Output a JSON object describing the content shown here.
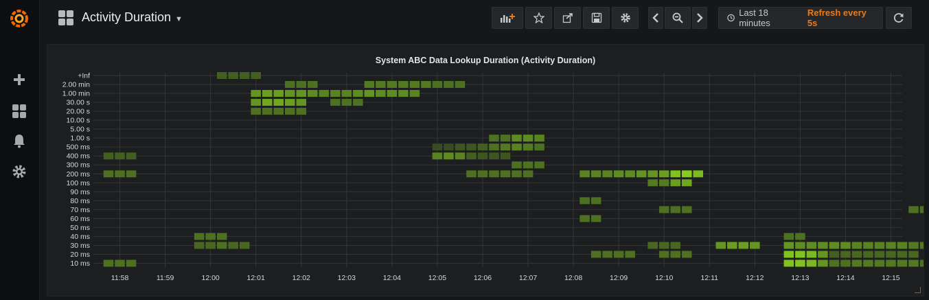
{
  "dashboard": {
    "title": "Activity Duration"
  },
  "toolbar": {
    "time_range": "Last 18 minutes",
    "refresh": "Refresh every 5s"
  },
  "icons": {
    "logo": "grafana-logo",
    "sidebar": [
      "plus-icon",
      "dashboards-icon",
      "bell-icon",
      "gear-icon"
    ],
    "toolbar": [
      "add-panel-icon",
      "star-icon",
      "share-icon",
      "save-icon",
      "settings-icon",
      "chevron-left-icon",
      "zoom-out-icon",
      "chevron-right-icon",
      "clock-icon",
      "refresh-icon"
    ]
  },
  "colors": {
    "accent": "#eb7b18",
    "cell_low": "#37591c",
    "cell_high": "#98ea1c"
  },
  "chart_data": {
    "type": "heatmap",
    "title": "System ABC Data Lookup Duration (Activity Duration)",
    "y_buckets": [
      "10 ms",
      "20 ms",
      "30 ms",
      "40 ms",
      "50 ms",
      "60 ms",
      "70 ms",
      "80 ms",
      "90 ms",
      "100 ms",
      "200 ms",
      "300 ms",
      "400 ms",
      "500 ms",
      "1.00 s",
      "5.00 s",
      "10.00 s",
      "20.00 s",
      "30.00 s",
      "1.00 min",
      "2.00 min",
      "+Inf"
    ],
    "x_ticks": [
      "11:58",
      "11:59",
      "12:00",
      "12:01",
      "12:02",
      "12:03",
      "12:04",
      "12:05",
      "12:06",
      "12:07",
      "12:08",
      "12:09",
      "12:10",
      "12:11",
      "12:12",
      "12:13",
      "12:14",
      "12:15"
    ],
    "x_start": "11:57:25",
    "x_end": "12:15:15",
    "slot_seconds": 15,
    "grid": true,
    "cells": [
      [
        "11:57:45",
        "10 ms",
        0.3
      ],
      [
        "11:58:00",
        "10 ms",
        0.3
      ],
      [
        "11:58:15",
        "10 ms",
        0.3
      ],
      [
        "11:57:45",
        "200 ms",
        0.3
      ],
      [
        "11:58:00",
        "200 ms",
        0.3
      ],
      [
        "11:58:15",
        "200 ms",
        0.3
      ],
      [
        "11:57:45",
        "400 ms",
        0.2
      ],
      [
        "11:58:00",
        "400 ms",
        0.2
      ],
      [
        "11:58:15",
        "400 ms",
        0.2
      ],
      [
        "11:59:45",
        "40 ms",
        0.3
      ],
      [
        "12:00:00",
        "40 ms",
        0.3
      ],
      [
        "12:00:15",
        "40 ms",
        0.3
      ],
      [
        "11:59:45",
        "30 ms",
        0.25
      ],
      [
        "12:00:00",
        "30 ms",
        0.25
      ],
      [
        "12:00:15",
        "30 ms",
        0.3
      ],
      [
        "12:00:30",
        "30 ms",
        0.25
      ],
      [
        "12:00:45",
        "30 ms",
        0.25
      ],
      [
        "12:00:15",
        "+Inf",
        0.2
      ],
      [
        "12:00:30",
        "+Inf",
        0.2
      ],
      [
        "12:00:45",
        "+Inf",
        0.2
      ],
      [
        "12:01:00",
        "+Inf",
        0.2
      ],
      [
        "12:01:00",
        "20.00 s",
        0.3
      ],
      [
        "12:01:15",
        "20.00 s",
        0.3
      ],
      [
        "12:01:30",
        "20.00 s",
        0.3
      ],
      [
        "12:01:45",
        "20.00 s",
        0.3
      ],
      [
        "12:02:00",
        "20.00 s",
        0.3
      ],
      [
        "12:01:00",
        "30.00 s",
        0.5
      ],
      [
        "12:01:15",
        "30.00 s",
        0.6
      ],
      [
        "12:01:30",
        "30.00 s",
        0.6
      ],
      [
        "12:01:45",
        "30.00 s",
        0.55
      ],
      [
        "12:02:00",
        "30.00 s",
        0.5
      ],
      [
        "12:02:45",
        "30.00 s",
        0.3
      ],
      [
        "12:03:00",
        "30.00 s",
        0.3
      ],
      [
        "12:03:15",
        "30.00 s",
        0.3
      ],
      [
        "12:01:00",
        "1.00 min",
        0.5
      ],
      [
        "12:01:15",
        "1.00 min",
        0.55
      ],
      [
        "12:01:30",
        "1.00 min",
        0.55
      ],
      [
        "12:01:45",
        "1.00 min",
        0.5
      ],
      [
        "12:02:00",
        "1.00 min",
        0.5
      ],
      [
        "12:02:15",
        "1.00 min",
        0.45
      ],
      [
        "12:02:30",
        "1.00 min",
        0.4
      ],
      [
        "12:02:45",
        "1.00 min",
        0.4
      ],
      [
        "12:03:00",
        "1.00 min",
        0.4
      ],
      [
        "12:03:15",
        "1.00 min",
        0.45
      ],
      [
        "12:03:30",
        "1.00 min",
        0.5
      ],
      [
        "12:03:45",
        "1.00 min",
        0.45
      ],
      [
        "12:04:00",
        "1.00 min",
        0.45
      ],
      [
        "12:04:15",
        "1.00 min",
        0.45
      ],
      [
        "12:04:30",
        "1.00 min",
        0.4
      ],
      [
        "12:01:45",
        "2.00 min",
        0.3
      ],
      [
        "12:02:00",
        "2.00 min",
        0.3
      ],
      [
        "12:02:15",
        "2.00 min",
        0.3
      ],
      [
        "12:03:30",
        "2.00 min",
        0.35
      ],
      [
        "12:03:45",
        "2.00 min",
        0.35
      ],
      [
        "12:04:00",
        "2.00 min",
        0.35
      ],
      [
        "12:04:15",
        "2.00 min",
        0.35
      ],
      [
        "12:04:30",
        "2.00 min",
        0.35
      ],
      [
        "12:04:45",
        "2.00 min",
        0.35
      ],
      [
        "12:05:00",
        "2.00 min",
        0.3
      ],
      [
        "12:05:15",
        "2.00 min",
        0.3
      ],
      [
        "12:05:30",
        "2.00 min",
        0.3
      ],
      [
        "12:05:00",
        "500 ms",
        0.1
      ],
      [
        "12:05:15",
        "500 ms",
        0.1
      ],
      [
        "12:05:30",
        "500 ms",
        0.15
      ],
      [
        "12:05:45",
        "500 ms",
        0.15
      ],
      [
        "12:06:00",
        "500 ms",
        0.2
      ],
      [
        "12:06:15",
        "500 ms",
        0.3
      ],
      [
        "12:06:30",
        "500 ms",
        0.35
      ],
      [
        "12:06:45",
        "500 ms",
        0.4
      ],
      [
        "12:07:00",
        "500 ms",
        0.35
      ],
      [
        "12:07:15",
        "500 ms",
        0.3
      ],
      [
        "12:05:00",
        "400 ms",
        0.4
      ],
      [
        "12:05:15",
        "400 ms",
        0.45
      ],
      [
        "12:05:30",
        "400 ms",
        0.4
      ],
      [
        "12:05:45",
        "400 ms",
        0.2
      ],
      [
        "12:06:00",
        "400 ms",
        0.15
      ],
      [
        "12:06:15",
        "400 ms",
        0.15
      ],
      [
        "12:06:30",
        "400 ms",
        0.15
      ],
      [
        "12:06:15",
        "1.00 s",
        0.3
      ],
      [
        "12:06:30",
        "1.00 s",
        0.3
      ],
      [
        "12:06:45",
        "1.00 s",
        0.45
      ],
      [
        "12:07:00",
        "1.00 s",
        0.45
      ],
      [
        "12:07:15",
        "1.00 s",
        0.4
      ],
      [
        "12:06:45",
        "300 ms",
        0.3
      ],
      [
        "12:07:00",
        "300 ms",
        0.3
      ],
      [
        "12:07:15",
        "300 ms",
        0.3
      ],
      [
        "12:05:45",
        "200 ms",
        0.3
      ],
      [
        "12:06:00",
        "200 ms",
        0.3
      ],
      [
        "12:06:15",
        "200 ms",
        0.3
      ],
      [
        "12:06:30",
        "200 ms",
        0.3
      ],
      [
        "12:06:45",
        "200 ms",
        0.3
      ],
      [
        "12:07:00",
        "200 ms",
        0.3
      ],
      [
        "12:08:15",
        "200 ms",
        0.4
      ],
      [
        "12:08:30",
        "200 ms",
        0.4
      ],
      [
        "12:08:45",
        "200 ms",
        0.4
      ],
      [
        "12:09:00",
        "200 ms",
        0.45
      ],
      [
        "12:09:15",
        "200 ms",
        0.45
      ],
      [
        "12:09:30",
        "200 ms",
        0.5
      ],
      [
        "12:09:45",
        "200 ms",
        0.5
      ],
      [
        "12:10:00",
        "200 ms",
        0.55
      ],
      [
        "12:10:15",
        "200 ms",
        0.75
      ],
      [
        "12:10:30",
        "200 ms",
        0.8
      ],
      [
        "12:10:45",
        "200 ms",
        0.7
      ],
      [
        "12:09:45",
        "100 ms",
        0.35
      ],
      [
        "12:10:00",
        "100 ms",
        0.35
      ],
      [
        "12:10:15",
        "100 ms",
        0.55
      ],
      [
        "12:10:30",
        "100 ms",
        0.6
      ],
      [
        "12:08:15",
        "80 ms",
        0.3
      ],
      [
        "12:08:30",
        "80 ms",
        0.3
      ],
      [
        "12:10:00",
        "70 ms",
        0.3
      ],
      [
        "12:10:15",
        "70 ms",
        0.3
      ],
      [
        "12:10:30",
        "70 ms",
        0.3
      ],
      [
        "12:08:15",
        "60 ms",
        0.3
      ],
      [
        "12:08:30",
        "60 ms",
        0.3
      ],
      [
        "12:08:30",
        "20 ms",
        0.3
      ],
      [
        "12:08:45",
        "20 ms",
        0.3
      ],
      [
        "12:09:00",
        "20 ms",
        0.3
      ],
      [
        "12:09:15",
        "20 ms",
        0.3
      ],
      [
        "12:10:00",
        "20 ms",
        0.3
      ],
      [
        "12:10:15",
        "20 ms",
        0.3
      ],
      [
        "12:10:30",
        "20 ms",
        0.3
      ],
      [
        "12:09:45",
        "30 ms",
        0.25
      ],
      [
        "12:10:00",
        "30 ms",
        0.25
      ],
      [
        "12:10:15",
        "30 ms",
        0.25
      ],
      [
        "12:11:15",
        "30 ms",
        0.5
      ],
      [
        "12:11:30",
        "30 ms",
        0.55
      ],
      [
        "12:11:45",
        "30 ms",
        0.55
      ],
      [
        "12:12:00",
        "30 ms",
        0.5
      ],
      [
        "12:12:45",
        "40 ms",
        0.3
      ],
      [
        "12:13:00",
        "40 ms",
        0.3
      ],
      [
        "12:12:45",
        "30 ms",
        0.5
      ],
      [
        "12:13:00",
        "30 ms",
        0.45
      ],
      [
        "12:13:15",
        "30 ms",
        0.45
      ],
      [
        "12:13:30",
        "30 ms",
        0.45
      ],
      [
        "12:13:45",
        "30 ms",
        0.45
      ],
      [
        "12:14:00",
        "30 ms",
        0.45
      ],
      [
        "12:14:15",
        "30 ms",
        0.4
      ],
      [
        "12:14:30",
        "30 ms",
        0.4
      ],
      [
        "12:14:45",
        "30 ms",
        0.4
      ],
      [
        "12:15:00",
        "30 ms",
        0.4
      ],
      [
        "12:15:15",
        "30 ms",
        0.4
      ],
      [
        "12:15:30",
        "30 ms",
        0.35
      ],
      [
        "12:15:45",
        "30 ms",
        0.35
      ],
      [
        "12:12:45",
        "20 ms",
        0.75
      ],
      [
        "12:13:00",
        "20 ms",
        0.75
      ],
      [
        "12:13:15",
        "20 ms",
        0.7
      ],
      [
        "12:13:30",
        "20 ms",
        0.5
      ],
      [
        "12:13:45",
        "20 ms",
        0.2
      ],
      [
        "12:14:00",
        "20 ms",
        0.25
      ],
      [
        "12:14:15",
        "20 ms",
        0.25
      ],
      [
        "12:14:30",
        "20 ms",
        0.25
      ],
      [
        "12:14:45",
        "20 ms",
        0.25
      ],
      [
        "12:15:00",
        "20 ms",
        0.25
      ],
      [
        "12:15:15",
        "20 ms",
        0.25
      ],
      [
        "12:15:30",
        "20 ms",
        0.25
      ],
      [
        "12:12:45",
        "10 ms",
        0.75
      ],
      [
        "12:13:00",
        "10 ms",
        0.75
      ],
      [
        "12:13:15",
        "10 ms",
        0.7
      ],
      [
        "12:13:30",
        "10 ms",
        0.5
      ],
      [
        "12:13:45",
        "10 ms",
        0.3
      ],
      [
        "12:14:00",
        "10 ms",
        0.3
      ],
      [
        "12:14:15",
        "10 ms",
        0.35
      ],
      [
        "12:14:30",
        "10 ms",
        0.35
      ],
      [
        "12:14:45",
        "10 ms",
        0.35
      ],
      [
        "12:15:00",
        "10 ms",
        0.35
      ],
      [
        "12:15:15",
        "10 ms",
        0.35
      ],
      [
        "12:15:30",
        "10 ms",
        0.35
      ],
      [
        "12:15:45",
        "10 ms",
        0.3
      ],
      [
        "12:15:30",
        "70 ms",
        0.3
      ],
      [
        "12:15:45",
        "70 ms",
        0.3
      ],
      [
        "12:16:00",
        "70 ms",
        0.3
      ]
    ]
  }
}
